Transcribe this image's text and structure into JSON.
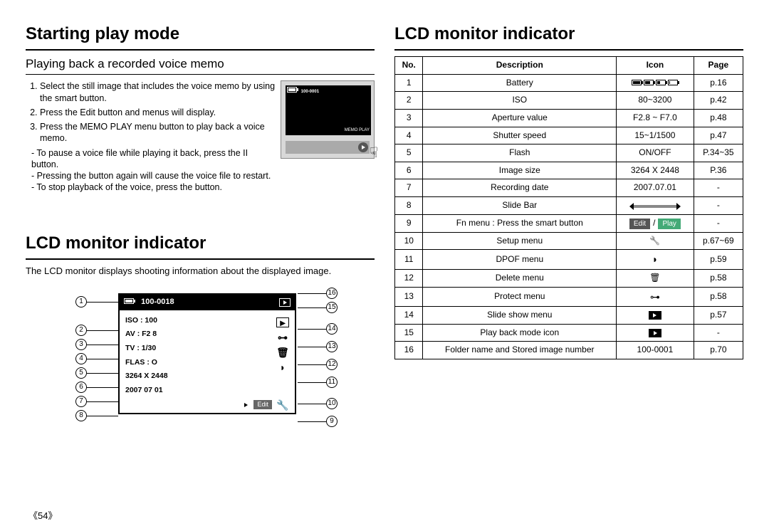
{
  "page_number": "《54》",
  "left": {
    "title": "Starting play mode",
    "section1_heading": "Playing back a recorded voice memo",
    "steps": [
      "Select the still image that includes the voice memo by using the smart button.",
      "Press the Edit button and menus will display.",
      "Press the MEMO PLAY menu button to play back a voice memo."
    ],
    "notes": [
      "- To pause a voice file while playing it back, press the II button.",
      "- Pressing the       button again will cause the voice file to restart.",
      "- To stop playback of the voice, press the       button."
    ],
    "ss1_topbar": "100-0001",
    "ss1_memoplay": "MEMO PLAY",
    "section2_title": "LCD monitor indicator",
    "section2_intro": "The LCD monitor displays shooting information about the displayed image.",
    "lcd": {
      "folder": "100-0018",
      "iso": "ISO : 100",
      "av": "AV : F2 8",
      "tv": "TV : 1/30",
      "flash": "FLAS    : O",
      "size": "3264 X 2448",
      "date": "2007 07 01",
      "edit": "Edit"
    },
    "callouts_left": [
      "①",
      "②",
      "③",
      "④",
      "⑤",
      "⑥",
      "⑦",
      "⑧"
    ],
    "callouts_right": [
      "⑯",
      "⑮",
      "⑭",
      "⑬",
      "⑫",
      "⑪",
      "⑩",
      "⑨"
    ]
  },
  "right": {
    "title": "LCD monitor indicator",
    "headers": [
      "No.",
      "Description",
      "Icon",
      "Page"
    ],
    "rows": [
      {
        "no": "1",
        "desc": "Battery",
        "icon": "battery-group",
        "page": "p.16"
      },
      {
        "no": "2",
        "desc": "ISO",
        "icon_text": "80~3200",
        "page": "p.42"
      },
      {
        "no": "3",
        "desc": "Aperture value",
        "icon_text": "F2.8 ~ F7.0",
        "page": "p.48"
      },
      {
        "no": "4",
        "desc": "Shutter speed",
        "icon_text": "15~1/1500",
        "page": "p.47"
      },
      {
        "no": "5",
        "desc": "Flash",
        "icon_text": "ON/OFF",
        "page": "P.34~35"
      },
      {
        "no": "6",
        "desc": "Image size",
        "icon_text": "3264 X 2448",
        "page": "P.36"
      },
      {
        "no": "7",
        "desc": "Recording date",
        "icon_text": "2007.07.01",
        "page": "-"
      },
      {
        "no": "8",
        "desc": "Slide Bar",
        "icon": "slidebar",
        "page": "-"
      },
      {
        "no": "9",
        "desc": "Fn menu : Press the smart button",
        "icon": "edit-play-badges",
        "page": "-"
      },
      {
        "no": "10",
        "desc": "Setup menu",
        "icon": "wrench",
        "page": "p.67~69"
      },
      {
        "no": "11",
        "desc": "DPOF menu",
        "icon": "dpof",
        "page": "p.59"
      },
      {
        "no": "12",
        "desc": "Delete menu",
        "icon": "trash",
        "page": "p.58"
      },
      {
        "no": "13",
        "desc": "Protect menu",
        "icon": "key",
        "page": "p.58"
      },
      {
        "no": "14",
        "desc": "Slide show menu",
        "icon": "slideshow",
        "page": "p.57"
      },
      {
        "no": "15",
        "desc": "Play back mode icon",
        "icon": "playback",
        "page": "-"
      },
      {
        "no": "16",
        "desc": "Folder name and Stored image number",
        "icon_text": "100-0001",
        "page": "p.70"
      }
    ],
    "badge_edit": "Edit",
    "badge_play": "Play",
    "badge_sep": "/"
  }
}
